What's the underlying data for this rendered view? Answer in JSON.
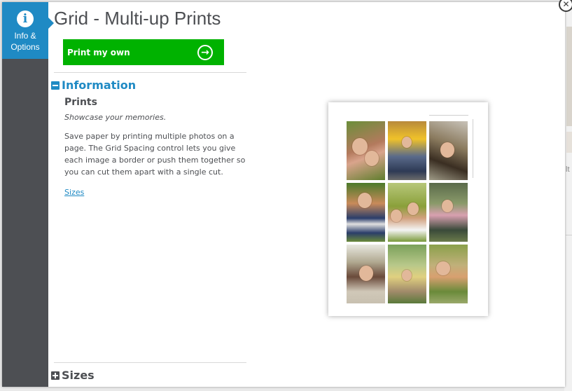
{
  "window": {
    "title": "Grid - Multi-up Prints"
  },
  "sidebar": {
    "tab_label": "Info & Options",
    "tab_icon": "info-icon",
    "accent_color": "#1f8ac4",
    "background_color": "#4d4f53"
  },
  "actions": {
    "print_label": "Print my own",
    "print_icon": "arrow-right-circle-icon",
    "print_color": "#00b200"
  },
  "info": {
    "heading": "Information",
    "heading_icon": "minus-box-icon",
    "product_title": "Prints",
    "tagline": "Showcase your memories.",
    "description": "Save paper by printing multiple photos on a page. The Grid Spacing control lets you give each image a border or push them together so you can cut them apart with a single cut.",
    "sizes_link": "Sizes"
  },
  "sizes_section": {
    "heading": "Sizes",
    "heading_icon": "plus-box-icon"
  },
  "preview": {
    "photos": [
      "girls-smiling-photo",
      "boy-with-backpack-photo",
      "child-portrait-photo",
      "toddler-on-playground-photo",
      "parent-and-child-photo",
      "child-on-swing-photo",
      "boy-smiling-photo",
      "child-in-field-photo",
      "girl-lying-in-grass-photo"
    ]
  },
  "close": {
    "icon": "close-icon"
  },
  "backdrop": {
    "partial_text": "lt"
  }
}
